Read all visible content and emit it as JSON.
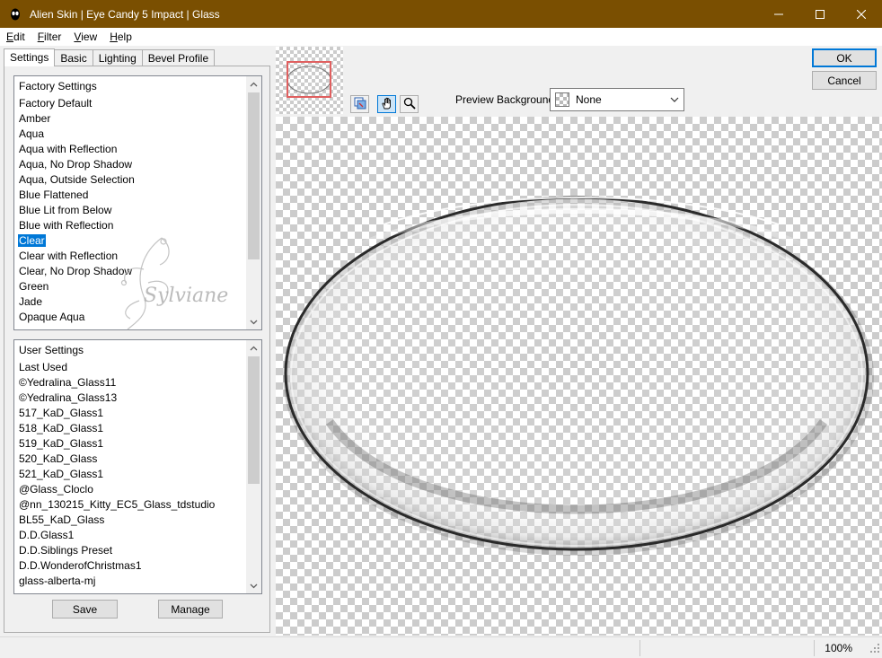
{
  "window": {
    "title": "Alien Skin | Eye Candy 5 Impact | Glass",
    "title_color": "#7a4f01"
  },
  "menu": [
    {
      "label_ul": "E",
      "label_rest": "dit"
    },
    {
      "label_ul": "F",
      "label_rest": "ilter"
    },
    {
      "label_ul": "V",
      "label_rest": "iew"
    },
    {
      "label_ul": "H",
      "label_rest": "elp"
    }
  ],
  "tabs": [
    "Settings",
    "Basic",
    "Lighting",
    "Bevel Profile"
  ],
  "factory_settings": {
    "header": "Factory Settings",
    "items": [
      "Factory Default",
      "Amber",
      "Aqua",
      "Aqua with Reflection",
      "Aqua, No Drop Shadow",
      "Aqua, Outside Selection",
      "Blue Flattened",
      "Blue Lit from Below",
      "Blue with Reflection",
      "Clear",
      "Clear with Reflection",
      "Clear, No Drop Shadow",
      "Green",
      "Jade",
      "Opaque Aqua"
    ],
    "selected": "Clear"
  },
  "user_settings": {
    "header": "User Settings",
    "items": [
      "Last Used",
      "©Yedralina_Glass11",
      "©Yedralina_Glass13",
      "517_KaD_Glass1",
      "518_KaD_Glass1",
      "519_KaD_Glass1",
      "520_KaD_Glass",
      "521_KaD_Glass1",
      "@Glass_Cloclo",
      "@nn_130215_Kitty_EC5_Glass_tdstudio",
      "BL55_KaD_Glass",
      "D.D.Glass1",
      "D.D.Siblings Preset",
      "D.D.WonderofChristmas1",
      "glass-alberta-mj"
    ]
  },
  "buttons": {
    "save": "Save",
    "manage": "Manage",
    "ok": "OK",
    "cancel": "Cancel"
  },
  "preview_background": {
    "label": "Preview Background:",
    "value": "None"
  },
  "watermark": "Sylviane",
  "status": {
    "zoom": "100%"
  },
  "colors": {
    "selection": "#0078d7",
    "thumbnail_frame": "#e06060"
  }
}
